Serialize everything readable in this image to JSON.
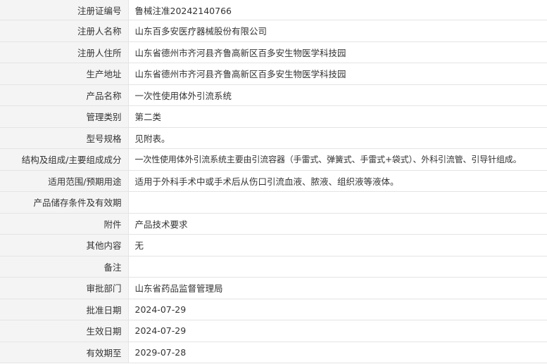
{
  "record": {
    "rows": [
      {
        "label": "注册证编号",
        "value": "鲁械注准20242140766"
      },
      {
        "label": "注册人名称",
        "value": "山东百多安医疗器械股份有限公司"
      },
      {
        "label": "注册人住所",
        "value": "山东省德州市齐河县齐鲁高新区百多安生物医学科技园"
      },
      {
        "label": "生产地址",
        "value": "山东省德州市齐河县齐鲁高新区百多安生物医学科技园"
      },
      {
        "label": "产品名称",
        "value": "一次性使用体外引流系统"
      },
      {
        "label": "管理类别",
        "value": "第二类"
      },
      {
        "label": "型号规格",
        "value": "见附表。"
      },
      {
        "label": "结构及组成/主要组成成分",
        "value": "一次性使用体外引流系统主要由引流容器（手雷式、弹簧式、手雷式+袋式）、外科引流管、引导针组成。"
      },
      {
        "label": "适用范围/预期用途",
        "value": "适用于外科手术中或手术后从伤口引流血液、脓液、组织液等液体。"
      },
      {
        "label": "产品储存条件及有效期",
        "value": ""
      },
      {
        "label": "附件",
        "value": "产品技术要求"
      },
      {
        "label": "其他内容",
        "value": "无"
      },
      {
        "label": "备注",
        "value": ""
      },
      {
        "label": "审批部门",
        "value": "山东省药品监督管理局"
      },
      {
        "label": "批准日期",
        "value": "2024-07-29"
      },
      {
        "label": "生效日期",
        "value": "2024-07-29"
      },
      {
        "label": "有效期至",
        "value": "2029-07-28"
      }
    ]
  }
}
